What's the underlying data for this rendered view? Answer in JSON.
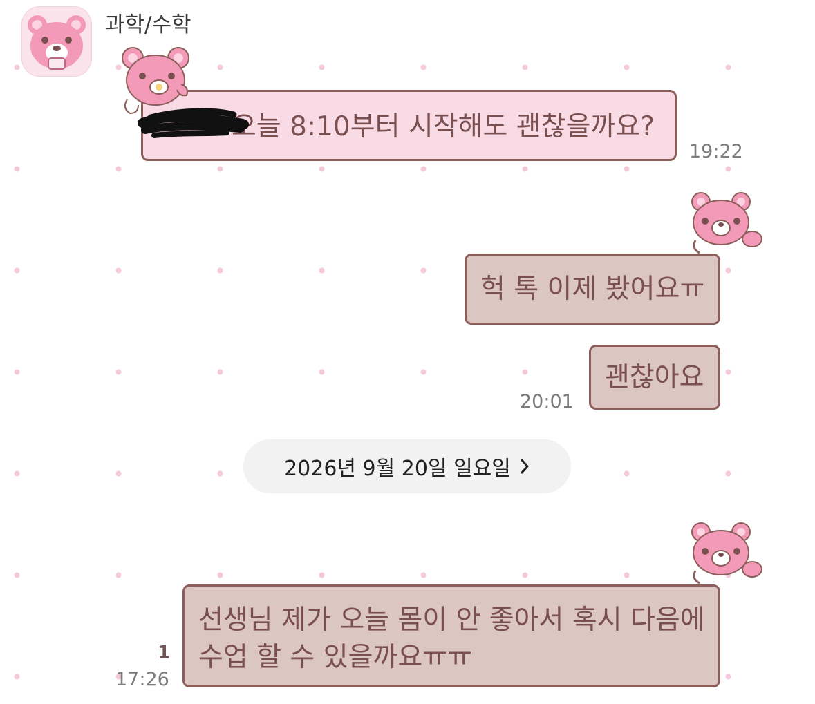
{
  "chat": {
    "name": "과학/수학"
  },
  "messages": [
    {
      "text": "오늘 8:10부터 시작해도 괜찮을까요?",
      "time": "19:22"
    },
    {
      "text": "헉 톡 이제 봤어요ㅠ"
    },
    {
      "text": "괜찮아요",
      "time": "20:01"
    },
    {
      "line1": "선생님 제가 오늘 몸이 안 좋아서 혹시 다음에",
      "line2": "수업 할 수 있을까요ㅠㅠ",
      "time": "17:26",
      "unread": "1"
    }
  ],
  "date_divider": {
    "label": "2026년 9월 20일 일요일",
    "icon": "chevron-right-icon"
  },
  "icons": {
    "avatar": "pink-bear-avatar-icon",
    "sticker": "pink-bear-sticker-icon"
  },
  "colors": {
    "incoming_bubble": "#f8dbe5",
    "outgoing_bubble": "#dcc6c2",
    "bubble_border": "#8b5e5a",
    "text": "#7a4f4f",
    "dot_pattern": "#f5c9dc"
  }
}
